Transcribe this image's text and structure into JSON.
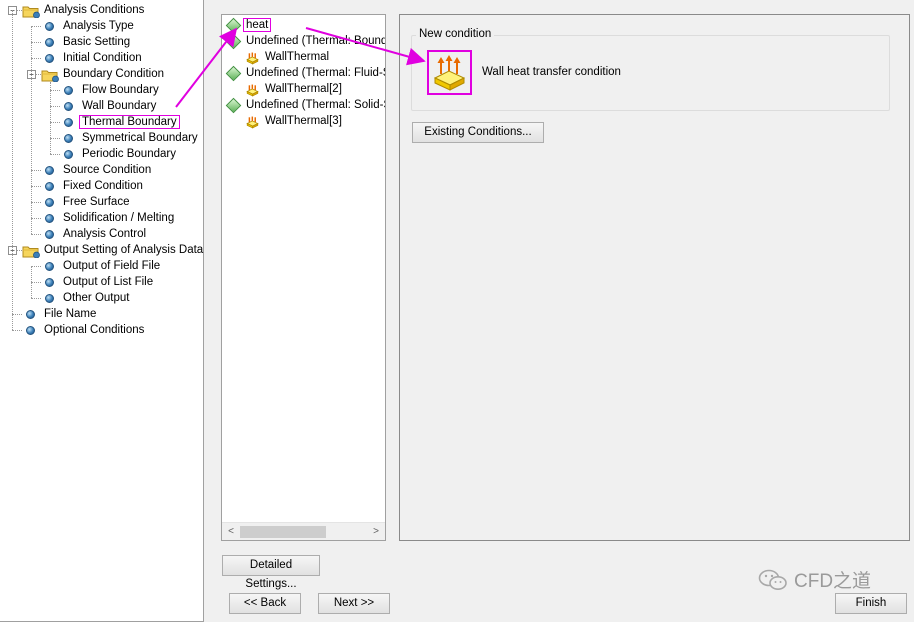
{
  "tree": {
    "items": [
      {
        "label": "Analysis Conditions",
        "depth": 0,
        "kind": "folder",
        "expander": "−"
      },
      {
        "label": "Analysis Type",
        "depth": 1,
        "kind": "leaf"
      },
      {
        "label": "Basic Setting",
        "depth": 1,
        "kind": "leaf"
      },
      {
        "label": "Initial Condition",
        "depth": 1,
        "kind": "leaf"
      },
      {
        "label": "Boundary Condition",
        "depth": 1,
        "kind": "folder",
        "expander": "−"
      },
      {
        "label": "Flow Boundary",
        "depth": 2,
        "kind": "leaf"
      },
      {
        "label": "Wall Boundary",
        "depth": 2,
        "kind": "leaf"
      },
      {
        "label": "Thermal Boundary",
        "depth": 2,
        "kind": "leaf",
        "selected": true
      },
      {
        "label": "Symmetrical Boundary",
        "depth": 2,
        "kind": "leaf"
      },
      {
        "label": "Periodic Boundary",
        "depth": 2,
        "kind": "leaf"
      },
      {
        "label": "Source Condition",
        "depth": 1,
        "kind": "leaf"
      },
      {
        "label": "Fixed Condition",
        "depth": 1,
        "kind": "leaf"
      },
      {
        "label": "Free Surface",
        "depth": 1,
        "kind": "leaf"
      },
      {
        "label": "Solidification / Melting",
        "depth": 1,
        "kind": "leaf"
      },
      {
        "label": "Analysis Control",
        "depth": 1,
        "kind": "leaf"
      },
      {
        "label": "Output Setting of Analysis Data",
        "depth": 0,
        "kind": "folder",
        "expander": "−"
      },
      {
        "label": "Output of Field File",
        "depth": 1,
        "kind": "leaf"
      },
      {
        "label": "Output of List File",
        "depth": 1,
        "kind": "leaf"
      },
      {
        "label": "Other Output",
        "depth": 1,
        "kind": "leaf"
      },
      {
        "label": "File Name",
        "depth": 0,
        "kind": "leaf"
      },
      {
        "label": "Optional Conditions",
        "depth": 0,
        "kind": "leaf"
      }
    ]
  },
  "conditions": {
    "items": [
      {
        "label": "heat",
        "kind": "group",
        "selected": true
      },
      {
        "label": "Undefined (Thermal: Bounda",
        "kind": "group"
      },
      {
        "label": "WallThermal",
        "kind": "thermal"
      },
      {
        "label": "Undefined (Thermal: Fluid-Sc",
        "kind": "group"
      },
      {
        "label": "WallThermal[2]",
        "kind": "thermal"
      },
      {
        "label": "Undefined (Thermal: Solid-Sc",
        "kind": "group"
      },
      {
        "label": "WallThermal[3]",
        "kind": "thermal"
      }
    ],
    "scroll_left": "<",
    "scroll_right": ">"
  },
  "detail": {
    "group_title": "New condition",
    "new_condition_label": "Wall heat transfer condition",
    "existing_button": "Existing Conditions..."
  },
  "buttons": {
    "detailed": "Detailed Settings...",
    "back": "<< Back",
    "next": "Next >>",
    "finish": "Finish"
  },
  "watermark": "CFD之道",
  "colors": {
    "highlight": "#e000e0",
    "accent": "#3b7fb8"
  }
}
